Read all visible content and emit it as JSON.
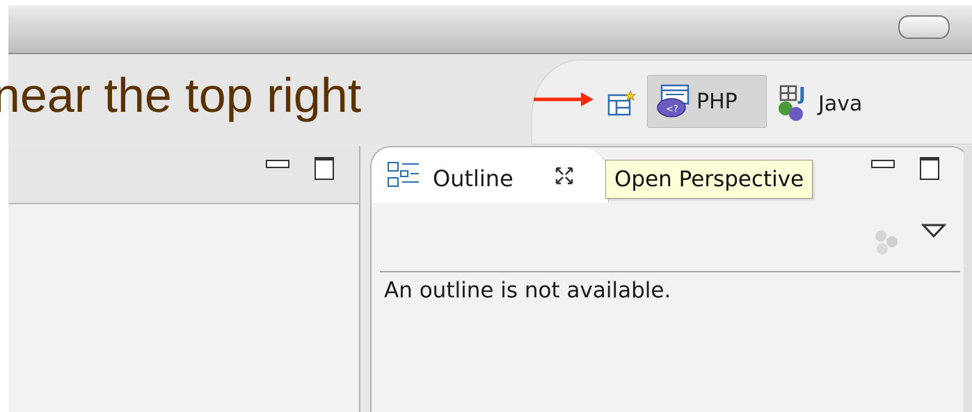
{
  "annotation": {
    "text": "near the top right",
    "color": "#5a3200",
    "arrow_color": "#ff2a00"
  },
  "perspective_bar": {
    "open_perspective_icon": "open-perspective-icon",
    "php": {
      "label": "PHP",
      "icon": "php-perspective-icon"
    },
    "java": {
      "label": "Java",
      "icon": "java-perspective-icon"
    }
  },
  "tooltip": {
    "text": "Open Perspective"
  },
  "outline_view": {
    "tab_label": "Outline",
    "message": "An outline is not available.",
    "close_glyph": "✕"
  },
  "colors": {
    "tooltip_bg": "#ffffd8",
    "php_icon": "#6a5cc0",
    "java_icon": "#4a7a2a"
  }
}
